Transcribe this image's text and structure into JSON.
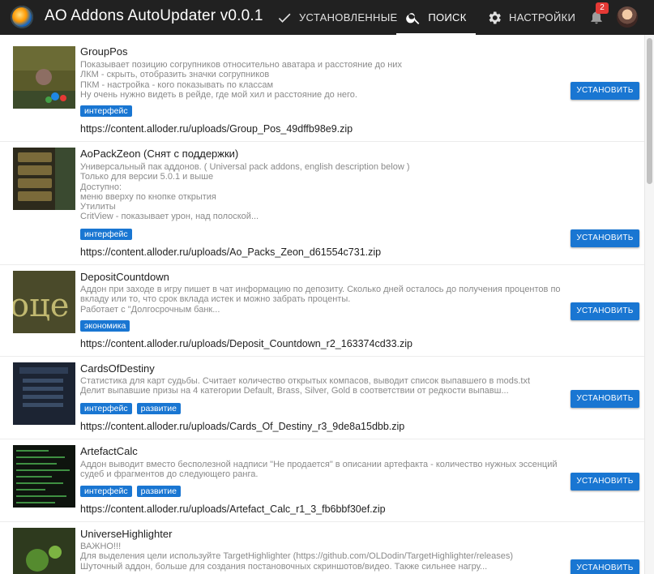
{
  "app": {
    "title": "AO Addons AutoUpdater v0.0.1",
    "notifications_count": "2"
  },
  "nav": {
    "installed_label": "УСТАНОВЛЕННЫЕ",
    "search_label": "ПОИСК",
    "settings_label": "НАСТРОЙКИ",
    "active_tab": "ПОИСК"
  },
  "install_label": "УСТАНОВИТЬ",
  "addons": [
    {
      "name": "GroupPos",
      "description": [
        "Показывает позицию согрупников относительно аватара и расстояние до них",
        "ЛКМ - скрыть, отобразить значки согрупников",
        "ПКМ - настройка - кого показывать по классам",
        "Ну очень нужно видеть в рейде, где мой хил и расстояние до него."
      ],
      "tags": [
        "интерфейс"
      ],
      "url": "https://content.alloder.ru/uploads/Group_Pos_49dffb98e9.zip"
    },
    {
      "name": "AoPackZeon (Снят с поддержки)",
      "description": [
        "Универсальный пак аддонов. ( Universal pack addons, english description below )",
        "Только для версии 5.0.1 и выше",
        "Доступно:",
        "меню вверху по кнопке открытия",
        "Утилиты",
        "CritView - показывает урон, над полоской..."
      ],
      "tags": [
        "интерфейс"
      ],
      "url": "https://content.alloder.ru/uploads/Ao_Packs_Zeon_d61554c731.zip"
    },
    {
      "name": "DepositCountdown",
      "description": [
        "Аддон при заходе в игру пишет в чат информацию по депозиту. Сколько дней осталось до получения процентов по",
        "вкладу или то, что срок вклада истек и можно забрать проценты.",
        "Работает с \"Долгосрочным банк..."
      ],
      "tags": [
        "экономика"
      ],
      "url": "https://content.alloder.ru/uploads/Deposit_Countdown_r2_163374cd33.zip"
    },
    {
      "name": "CardsOfDestiny",
      "description": [
        "Статистика для карт судьбы. Считает количество открытых компасов, выводит список выпавшего в mods.txt",
        "Делит выпавшие призы на 4 категории Default, Brass, Silver, Gold в соответствии от редкости выпавш..."
      ],
      "tags": [
        "интерфейс",
        "развитие"
      ],
      "url": "https://content.alloder.ru/uploads/Cards_Of_Destiny_r3_9de8a15dbb.zip"
    },
    {
      "name": "ArtefactCalc",
      "description": [
        "Аддон выводит вместо бесполезной надписи \"Не продается\" в описании артефакта - количество нужных эссенций",
        "судеб и фрагментов до следующего ранга."
      ],
      "tags": [
        "интерфейс",
        "развитие"
      ],
      "url": "https://content.alloder.ru/uploads/Artefact_Calc_r1_3_fb6bbf30ef.zip"
    },
    {
      "name": "UniverseHighlighter",
      "description": [
        "ВАЖНО!!!",
        "Для выделения цели используйте TargetHighlighter (https://github.com/OLDodin/TargetHighlighter/releases)",
        "Шуточный аддон, больше для создания постановочных скриншотов/видео. Также сильнее нагру..."
      ],
      "tags": [],
      "url": ""
    }
  ],
  "colors": {
    "appbar": "#212121",
    "accent": "#1976d2",
    "badge": "#e53935"
  }
}
